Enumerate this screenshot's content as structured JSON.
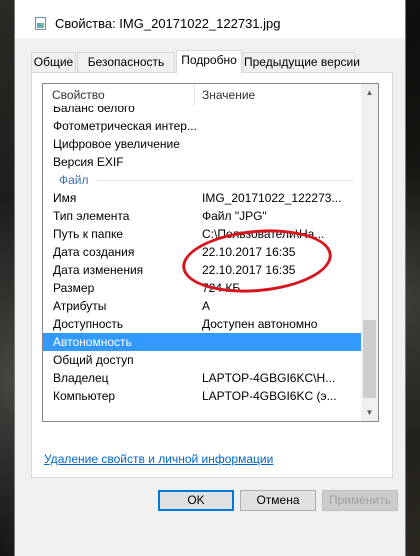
{
  "window": {
    "title": "Свойства: IMG_20171022_122731.jpg"
  },
  "tabs": [
    {
      "label": "Общие",
      "active": false
    },
    {
      "label": "Безопасность",
      "active": false
    },
    {
      "label": "Подробно",
      "active": true
    },
    {
      "label": "Предыдущие версии",
      "active": false
    }
  ],
  "list": {
    "header_property": "Свойство",
    "header_value": "Значение",
    "rows": [
      {
        "key": "Баланс белого",
        "value": ""
      },
      {
        "key": "Фотометрическая интер...",
        "value": ""
      },
      {
        "key": "Цифровое увеличение",
        "value": ""
      },
      {
        "key": "Версия EXIF",
        "value": ""
      },
      {
        "key": "Файл",
        "value": "",
        "group": true
      },
      {
        "key": "Имя",
        "value": "IMG_20171022_122273..."
      },
      {
        "key": "Тип элемента",
        "value": "Файл \"JPG\""
      },
      {
        "key": "Путь к папке",
        "value": "C:\\Пользователи\\На..."
      },
      {
        "key": "Дата создания",
        "value": "22.10.2017 16:35"
      },
      {
        "key": "Дата изменения",
        "value": "22.10.2017 16:35"
      },
      {
        "key": "Размер",
        "value": "724 КБ"
      },
      {
        "key": "Атрибуты",
        "value": "A"
      },
      {
        "key": "Доступность",
        "value": "Доступен автономно"
      },
      {
        "key": "Автономность",
        "value": "",
        "selected": true
      },
      {
        "key": "Общий доступ",
        "value": ""
      },
      {
        "key": "Владелец",
        "value": "LAPTOP-4GBGI6KC\\H..."
      },
      {
        "key": "Компьютер",
        "value": "LAPTOP-4GBGI6KC (э..."
      }
    ]
  },
  "remove_properties_link": "Удаление свойств и личной информации",
  "buttons": {
    "ok": "OK",
    "cancel": "Отмена",
    "apply": "Применить"
  },
  "icons": {
    "title": "image-file-icon",
    "scroll_up": "arrow-up-icon",
    "scroll_down": "arrow-down-icon"
  },
  "colors": {
    "selection": "#3399ff",
    "group_header": "#3c6fb0",
    "link": "#0066cc",
    "annotation": "#d8141c",
    "default_button_border": "#0078d7"
  }
}
